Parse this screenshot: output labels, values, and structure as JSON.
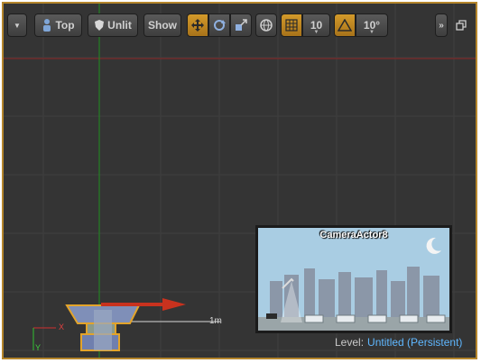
{
  "toolbar": {
    "view_mode_label": "Top",
    "lighting_label": "Unlit",
    "show_label": "Show",
    "grid_snap_value": "10",
    "rotation_snap_value": "10°"
  },
  "viewport": {
    "scale_label": "1m",
    "axis_x_label": "X",
    "axis_y_label": "Y"
  },
  "camera_preview": {
    "title": "CameraActor8"
  },
  "level": {
    "label": "Level:",
    "name": "Untitled (Persistent)"
  },
  "colors": {
    "accent": "#d39a2a",
    "frame_border": "#b5862c",
    "viewport_bg": "#343434",
    "level_name": "#5fb7ff"
  },
  "icons": {
    "menu": "chevron-down-icon",
    "view": "perspective-person-icon",
    "lighting": "shield-icon",
    "translate": "move-arrows-icon",
    "rotate": "rotate-icon",
    "scale": "scale-icon",
    "world": "globe-icon",
    "grid": "grid-icon",
    "angle": "triangle-angle-icon",
    "more": "double-chevron-icon",
    "maximize": "restore-window-icon"
  }
}
